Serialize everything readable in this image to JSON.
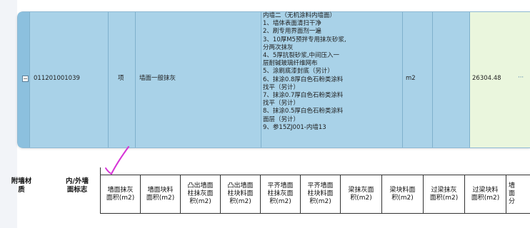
{
  "row": {
    "code": "011201001039",
    "unit_type": "项",
    "name": "墙面一般抹灰",
    "unit": "m2",
    "quantity": "26304.48",
    "more": "···",
    "expand": "−",
    "description": [
      "内墙二（无机涂料内墙面）",
      "1、墙体表面清扫干净",
      "2、刷专用界面剂一遍",
      "3、10厚M5预拌专用抹灰砂浆,",
      "分两次抹灰",
      "4、5厚抗裂砂浆,中间压入一",
      "层耐碱玻璃纤维网布",
      "5、涂刷底漆封底（另计）",
      "6、抹涂0.8厚白色石粉类涂料",
      "找平（另计）",
      "7、抹涂0.7厚白色石粉类涂料",
      "找平（另计）",
      "8、抹涂0.5厚白色石粉类涂料",
      "面层（另计）",
      "9、参15ZJ001-内墙13"
    ]
  },
  "header": {
    "col_material": [
      "附墙材",
      "质"
    ],
    "col_inout": [
      "内/外墙",
      "面标志"
    ],
    "columns": [
      [
        "墙面抹灰",
        "面积(m2)"
      ],
      [
        "墙面块料",
        "面积(m2)"
      ],
      [
        "凸出墙面",
        "柱抹灰面",
        "积(m2)"
      ],
      [
        "凸出墙面",
        "柱块料面",
        "积(m2)"
      ],
      [
        "平齐墙面",
        "柱抹灰面",
        "积(m2)"
      ],
      [
        "平齐墙面",
        "柱块料面",
        "积(m2)"
      ],
      [
        "梁抹灰面",
        "积(m2)"
      ],
      [
        "梁块料面",
        "积(m2)"
      ],
      [
        "过梁抹灰",
        "面积(m2)"
      ],
      [
        "过梁块料",
        "面积(m2)"
      ],
      [
        "墙",
        "面",
        "分"
      ]
    ]
  },
  "colors": {
    "row_bg": "#a9d2e8",
    "quantity_bg": "#eaf6dd",
    "annotation": "#d633d6"
  }
}
